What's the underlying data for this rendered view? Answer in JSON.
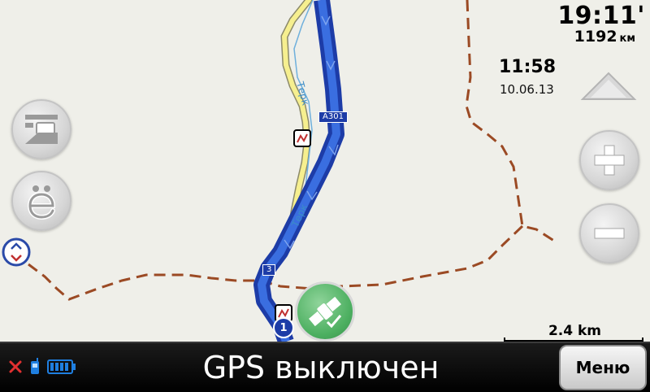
{
  "navigation": {
    "time_remaining": "19:11'",
    "distance_remaining": "1192",
    "distance_unit": "км",
    "clock": "11:58",
    "date": "10.06.13"
  },
  "map": {
    "road_labels": [
      "A301",
      "3"
    ],
    "river_labels": [
      "Терк",
      "Терк"
    ],
    "route_point_number": "1",
    "scale_text": "2.4 km",
    "colors": {
      "route": "#1d3ca7",
      "road_yellow": "#f6ef8f",
      "boundary": "#9b4a24",
      "background": "#efefe9"
    }
  },
  "buttons": {
    "left_top_icon": "speed-camera-icon",
    "left_mid_icon": "letter-yo-icon",
    "zoom_in_icon": "plus-icon",
    "zoom_out_icon": "minus-icon",
    "scroll_up_icon": "triangle-up-icon",
    "gps_icon": "satellite-icon"
  },
  "status_bar": {
    "gps_status": "GPS выключен",
    "menu_label": "Меню",
    "icons": [
      "gps-off-x-icon",
      "phone-icon",
      "battery-icon"
    ]
  }
}
